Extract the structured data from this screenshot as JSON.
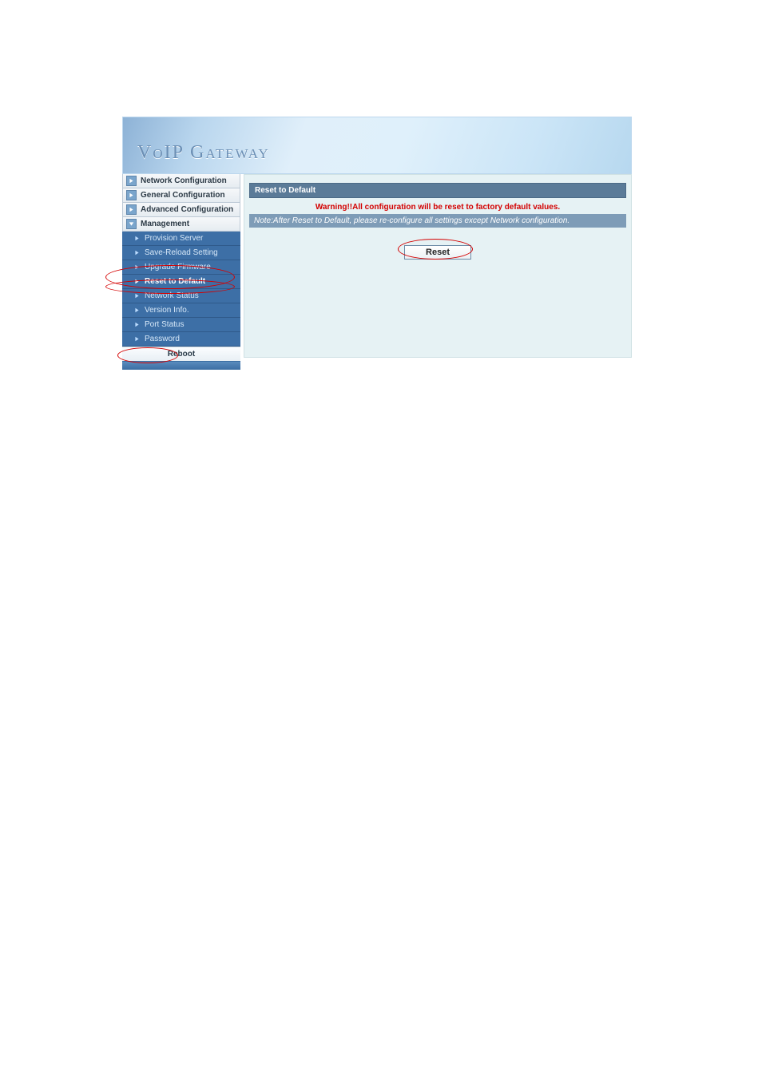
{
  "banner": {
    "title": "VoIP  Gateway"
  },
  "sidebar": {
    "categories": [
      {
        "label": "Network Configuration"
      },
      {
        "label": "General Configuration"
      },
      {
        "label": "Advanced Configuration"
      },
      {
        "label": "Management"
      }
    ],
    "sub_items": [
      {
        "label": "Provision Server"
      },
      {
        "label": "Save-Reload Setting"
      },
      {
        "label": "Upgrade Firmware"
      },
      {
        "label": "Reset to Default"
      },
      {
        "label": "Network Status"
      },
      {
        "label": "Version Info."
      },
      {
        "label": "Port Status"
      },
      {
        "label": "Password"
      }
    ],
    "bottom": {
      "label": "Reboot"
    }
  },
  "panel": {
    "header": "Reset to Default",
    "warning": "Warning!!All configuration will be reset to factory default values.",
    "note": "Note:After Reset to Default, please re-configure all settings except Network configuration.",
    "reset_button": "Reset"
  }
}
